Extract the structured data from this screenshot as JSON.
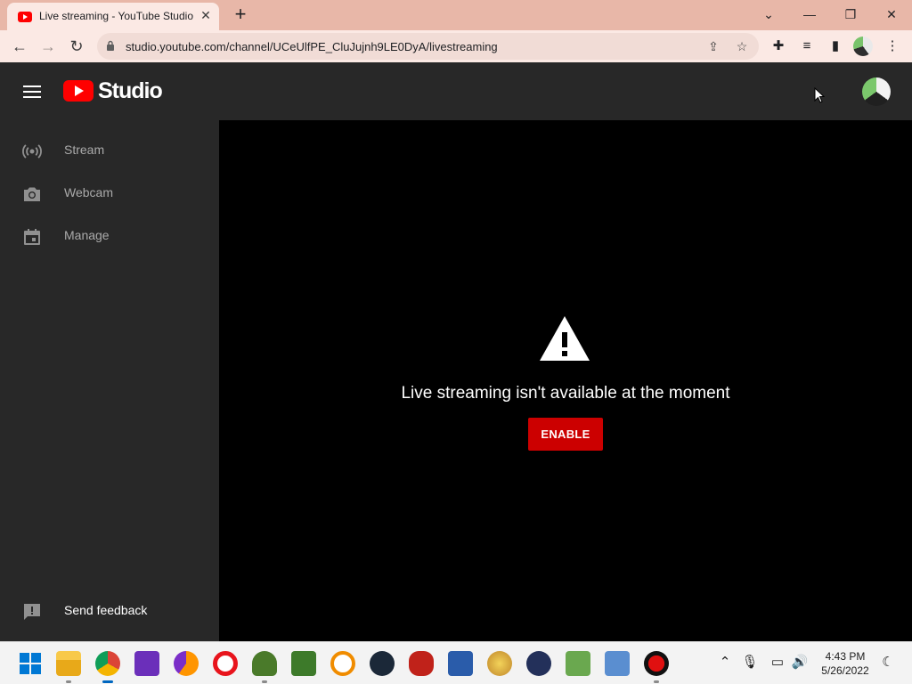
{
  "browser": {
    "tab_title": "Live streaming - YouTube Studio",
    "url": "studio.youtube.com/channel/UCeUlfPE_CluJujnh9LE0DyA/livestreaming"
  },
  "header": {
    "logo_text": "Studio"
  },
  "sidebar": {
    "items": [
      {
        "label": "Stream",
        "icon": "broadcast-icon"
      },
      {
        "label": "Webcam",
        "icon": "camera-icon"
      },
      {
        "label": "Manage",
        "icon": "calendar-icon"
      }
    ],
    "feedback_label": "Send feedback"
  },
  "main": {
    "message": "Live streaming isn't available at the moment",
    "enable_label": "ENABLE"
  },
  "taskbar": {
    "time": "4:43 PM",
    "date": "5/26/2022"
  },
  "colors": {
    "accent": "#cc0000",
    "sidebar_bg": "#282828",
    "main_bg": "#000000",
    "tab_strip": "#e8b7a8"
  }
}
